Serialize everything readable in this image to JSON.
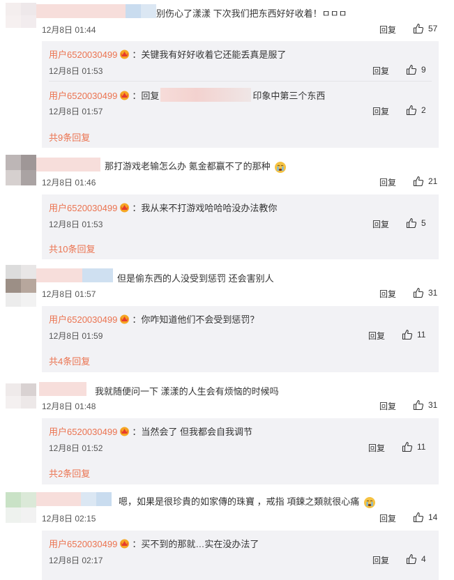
{
  "comments": [
    {
      "text": "别伤心了漾漾 下次我们把东西好好收着！ㅁㅁㅁ",
      "time": "12月8日 01:44",
      "reply": "回复",
      "likes": "57",
      "subs": [
        {
          "user": "用户6520030499",
          "prefix": "：",
          "text": "关键我有好好收着它还能丢真是服了",
          "time": "12月8日 01:53",
          "reply": "回复",
          "likes": "9"
        },
        {
          "user": "用户6520030499",
          "prefix": "：回复",
          "text": "印象中第三个东西",
          "time": "12月8日 01:57",
          "reply": "回复",
          "likes": "2"
        }
      ],
      "more": "共9条回复"
    },
    {
      "text": "那打游戏老输怎么办 氪金都赢不了的那种",
      "time": "12月8日 01:46",
      "reply": "回复",
      "likes": "21",
      "subs": [
        {
          "user": "用户6520030499",
          "prefix": "：",
          "text": "我从来不打游戏哈哈哈没办法教你",
          "time": "12月8日 01:53",
          "reply": "回复",
          "likes": "5"
        }
      ],
      "more": "共10条回复"
    },
    {
      "text": "但是偷东西的人没受到惩罚 还会害别人",
      "time": "12月8日 01:57",
      "reply": "回复",
      "likes": "31",
      "subs": [
        {
          "user": "用户6520030499",
          "prefix": "：",
          "text": "你咋知道他们不会受到惩罚？",
          "time": "12月8日 01:59",
          "reply": "回复",
          "likes": "11"
        }
      ],
      "more": "共4条回复"
    },
    {
      "text": "我就随便问一下 漾漾的人生会有烦恼的时候吗",
      "time": "12月8日 01:48",
      "reply": "回复",
      "likes": "31",
      "subs": [
        {
          "user": "用户6520030499",
          "prefix": "：",
          "text": "当然会了 但我都会自我调节",
          "time": "12月8日 01:52",
          "reply": "回复",
          "likes": "11"
        }
      ],
      "more": "共2条回复"
    },
    {
      "text": "嗯，如果是很珍貴的如家傳的珠寶 ，戒指 項鍊之類就很心痛",
      "time": "12月8日 02:15",
      "reply": "回复",
      "likes": "14",
      "subs": [
        {
          "user": "用户6520030499",
          "prefix": "：",
          "text": "买不到的那就…实在没办法了",
          "time": "12月8日 02:17",
          "reply": "回复",
          "likes": "4"
        }
      ],
      "more": ""
    }
  ],
  "colors": {
    "accent": "#eb7350",
    "subbox_bg": "#f2f2f5",
    "text": "#333333"
  },
  "icons": {
    "like": "thumb-up-icon",
    "crown": "vip-crown-icon",
    "cry": "crying-emoji-icon"
  }
}
